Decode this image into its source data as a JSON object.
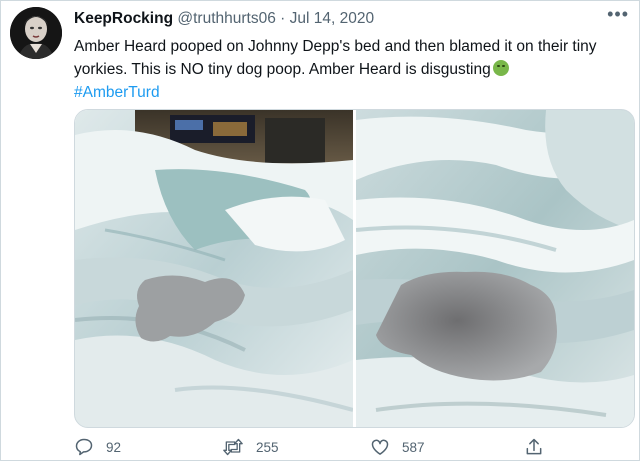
{
  "tweet": {
    "display_name": "KeepRocking",
    "handle": "@truthhurts06",
    "separator": "·",
    "date": "Jul 14, 2020",
    "more_label": "•••",
    "text": "Amber Heard pooped on Johnny Depp's bed and then blamed it on their tiny yorkies. This is NO tiny dog poop. Amber Heard is disgusting",
    "emoji": "nauseated-face-emoji",
    "hashtag": "#AmberTurd"
  },
  "actions": {
    "replies": "92",
    "retweets": "255",
    "likes": "587"
  },
  "colors": {
    "link": "#1d9bf0",
    "muted": "#536471",
    "text": "#0f1419",
    "border": "#cfd9de"
  },
  "icons": [
    "reply-icon",
    "retweet-icon",
    "like-icon",
    "share-icon",
    "more-icon"
  ]
}
